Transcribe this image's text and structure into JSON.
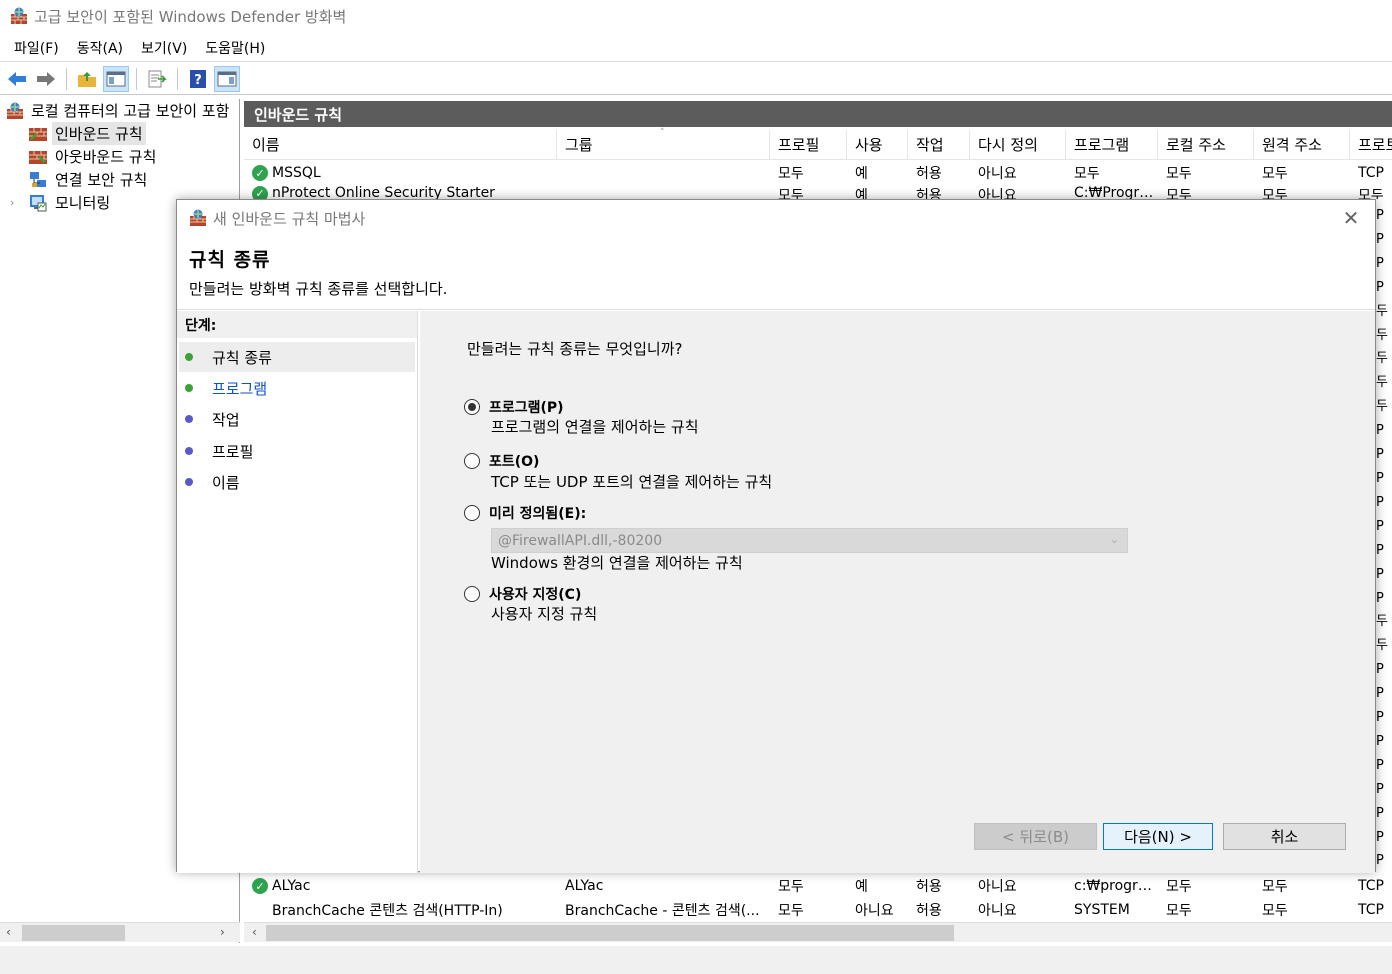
{
  "window": {
    "title": "고급 보안이 포함된 Windows Defender 방화벽"
  },
  "menu": [
    "파일(F)",
    "동작(A)",
    "보기(V)",
    "도움말(H)"
  ],
  "tree": {
    "root": "로컬 컴퓨터의 고급 보안이 포함",
    "items": [
      "인바운드 규칙",
      "아웃바운드 규칙",
      "연결 보안 규칙",
      "모니터링"
    ]
  },
  "main": {
    "header": "인바운드 규칙",
    "columns": [
      "이름",
      "그룹",
      "프로필",
      "사용",
      "작업",
      "다시 정의",
      "프로그램",
      "로컬 주소",
      "원격 주소",
      "프로토"
    ],
    "rows_top": [
      {
        "name": "MSSQL",
        "group": "",
        "profile": "모두",
        "enabled": "예",
        "action": "허용",
        "override": "아니요",
        "program": "모두",
        "local": "모두",
        "remote": "모두",
        "protocol": "TCP",
        "check": true
      },
      {
        "name": "nProtect Online Security Starter",
        "group": "",
        "profile": "모두",
        "enabled": "예",
        "action": "허용",
        "override": "아니요",
        "program": "C:₩Progra...",
        "local": "모두",
        "remote": "모두",
        "protocol": "모두",
        "check": true
      }
    ],
    "rows_bottom": [
      {
        "name": "ALYac",
        "group": "ALYac",
        "profile": "모두",
        "enabled": "예",
        "action": "허용",
        "override": "아니요",
        "program": "c:₩progra...",
        "local": "모두",
        "remote": "모두",
        "protocol": "TCP",
        "check": true
      },
      {
        "name": "BranchCache 콘텐츠 검색(HTTP-In)",
        "group": "BranchCache - 콘텐츠 검색(...",
        "profile": "모두",
        "enabled": "아니요",
        "action": "허용",
        "override": "아니요",
        "program": "SYSTEM",
        "local": "모두",
        "remote": "모두",
        "protocol": "TCP",
        "check": false
      }
    ],
    "right_fragments": [
      "P",
      "P",
      "P",
      "P",
      "두",
      "두",
      "두",
      "두",
      "두",
      "P",
      "P",
      "P",
      "P",
      "P",
      "P",
      "P",
      "P",
      "두",
      "두",
      "P",
      "P",
      "P",
      "P",
      "P",
      "P",
      "P",
      "P",
      "P"
    ]
  },
  "dialog": {
    "title": "새 인바운드 규칙 마법사",
    "heading": "규칙 종류",
    "subheading": "만들려는 방화벽 규칙 종류를 선택합니다.",
    "steps_title": "단계:",
    "steps": [
      {
        "label": "규칙 종류",
        "state": "current",
        "dot": "green"
      },
      {
        "label": "프로그램",
        "state": "link",
        "dot": "green"
      },
      {
        "label": "작업",
        "state": "normal",
        "dot": "blue"
      },
      {
        "label": "프로필",
        "state": "normal",
        "dot": "blue"
      },
      {
        "label": "이름",
        "state": "normal",
        "dot": "blue"
      }
    ],
    "question": "만들려는 규칙 종류는 무엇입니까?",
    "options": [
      {
        "label": "프로그램(P)",
        "desc": "프로그램의 연결을 제어하는 규칙",
        "selected": true
      },
      {
        "label": "포트(O)",
        "desc": "TCP 또는 UDP 포트의 연결을 제어하는 규칙",
        "selected": false
      },
      {
        "label": "미리 정의됨(E):",
        "desc": "Windows 환경의 연결을 제어하는 규칙",
        "selected": false
      },
      {
        "label": "사용자 지정(C)",
        "desc": "사용자 지정 규칙",
        "selected": false
      }
    ],
    "predefined_value": "@FirewallAPI.dll,-80200",
    "buttons": {
      "back": "< 뒤로(B)",
      "next": "다음(N) >",
      "cancel": "취소"
    }
  }
}
